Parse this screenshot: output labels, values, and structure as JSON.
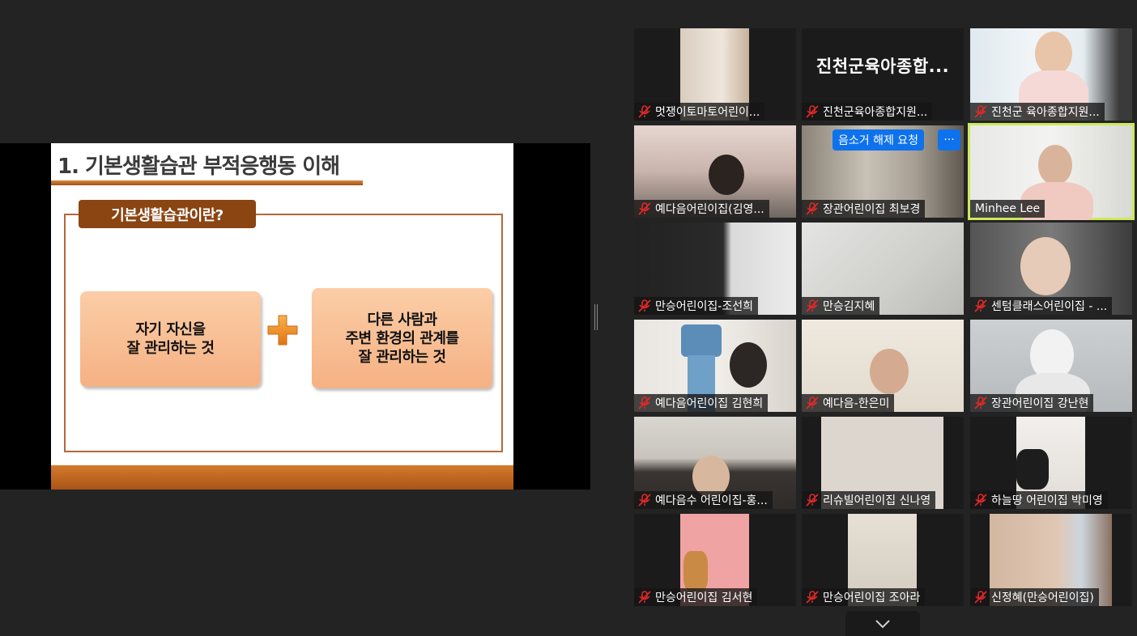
{
  "slide": {
    "title": "1. 기본생활습관 부적응행동 이해",
    "definition_tab": "기본생활습관이란?",
    "box_left": [
      "자기 자신을",
      "잘 관리하는 것"
    ],
    "box_right": [
      "다른 사람과",
      "주변 환경의 관계를",
      "잘 관리하는 것"
    ]
  },
  "gallery": {
    "unmute_request_label": "음소거 해제 요청",
    "more_label": "···",
    "big_name_tile": "진천군육아종합...",
    "participants": [
      "멋쟁이토마토어린이...",
      "진천군육아종합지원...",
      "진천군 육아종합지원...",
      "예다음어린이집(김영...",
      "장관어린이집 최보경",
      "Minhee Lee",
      "만승어린이집-조선희",
      "만승김지혜",
      "센텀클래스어린이집 - ...",
      "예다음어린이집 김현희",
      "예다음-한은미",
      "장관어린이집 강난현",
      "예다음수 어린이집-홍...",
      "리슈빌어린이집 신나영",
      "하늘땅 어린이집 박미영",
      "만승어린이집 김서현",
      "만승어린이집 조아라",
      "신정혜(만승어린이집)"
    ]
  },
  "colors": {
    "background": "#232323",
    "active_speaker": "#cde95a",
    "button_blue": "#0e72ed",
    "slide_brown": "#8b4512",
    "box_peach": "#f5b183"
  }
}
